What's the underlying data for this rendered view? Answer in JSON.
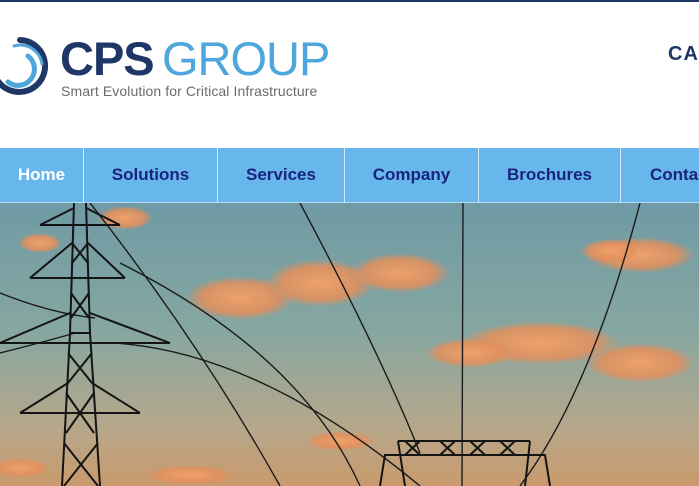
{
  "brand": {
    "logo_icon": "cps-swirl-logo-icon",
    "name_part1": "CPS",
    "name_part2": "GROUP",
    "tagline": "Smart Evolution for Critical Infrastructure"
  },
  "header": {
    "cta_label": "CA"
  },
  "nav": {
    "items": [
      {
        "label": "Home",
        "active": true
      },
      {
        "label": "Solutions"
      },
      {
        "label": "Services"
      },
      {
        "label": "Company"
      },
      {
        "label": "Brochures"
      },
      {
        "label": "Contac"
      }
    ]
  },
  "hero": {
    "image_subject": "power-transmission-towers-at-sunset"
  },
  "colors": {
    "brand_navy": "#1f3766",
    "brand_blue": "#4ea6dc",
    "nav_background": "#68b7ec",
    "nav_text": "#1a237e",
    "nav_active_text": "#ffffff"
  }
}
